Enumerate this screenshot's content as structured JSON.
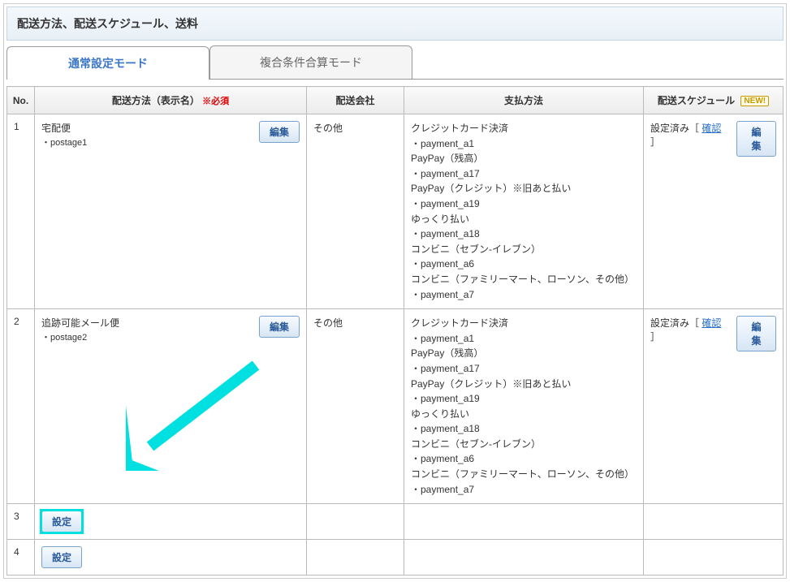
{
  "header": {
    "title": "配送方法、配送スケジュール、送料"
  },
  "tabs": {
    "normal": "通常設定モード",
    "complex": "複合条件合算モード"
  },
  "columns": {
    "no": "No.",
    "method": "配送方法（表示名）",
    "required": "※必須",
    "company": "配送会社",
    "payment": "支払方法",
    "schedule": "配送スケジュール",
    "new_badge": "NEW!"
  },
  "buttons": {
    "edit": "編集",
    "set": "設定"
  },
  "schedule_status": "設定済み［ ",
  "schedule_confirm": "確認",
  "schedule_status_close": " ］",
  "rows": [
    {
      "no": "1",
      "method_name": "宅配便",
      "method_code": "・postage1",
      "company": "その他",
      "payments": [
        "クレジットカード決済",
        "・payment_a1",
        "PayPay（残高）",
        "・payment_a17",
        "PayPay（クレジット）※旧あと払い",
        "・payment_a19",
        "ゆっくり払い",
        "・payment_a18",
        "コンビニ（セブン-イレブン）",
        "・payment_a6",
        "コンビニ（ファミリーマート、ローソン、その他）",
        "・payment_a7"
      ],
      "has_schedule": true,
      "configured": true
    },
    {
      "no": "2",
      "method_name": "追跡可能メール便",
      "method_code": "・postage2",
      "company": "その他",
      "payments": [
        "クレジットカード決済",
        "・payment_a1",
        "PayPay（残高）",
        "・payment_a17",
        "PayPay（クレジット）※旧あと払い",
        "・payment_a19",
        "ゆっくり払い",
        "・payment_a18",
        "コンビニ（セブン-イレブン）",
        "・payment_a6",
        "コンビニ（ファミリーマート、ローソン、その他）",
        "・payment_a7"
      ],
      "has_schedule": true,
      "configured": true
    },
    {
      "no": "3",
      "configured": false,
      "highlight": true
    },
    {
      "no": "4",
      "configured": false,
      "highlight": false
    }
  ]
}
